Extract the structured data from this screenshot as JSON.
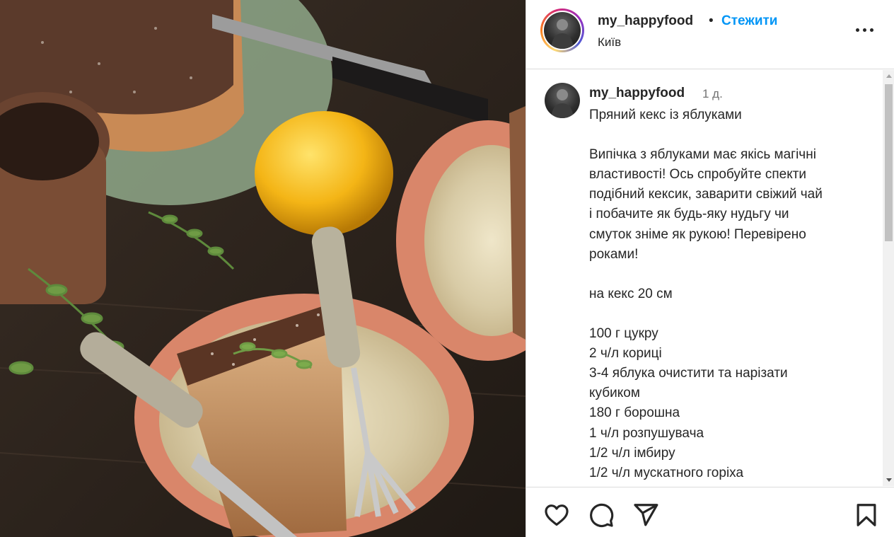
{
  "header": {
    "username": "my_happyfood",
    "dot": "•",
    "follow_label": "Стежити",
    "location": "Київ"
  },
  "caption": {
    "username": "my_happyfood",
    "time": "1 д.",
    "lines": [
      "Пряний кекс із яблуками",
      "",
      "Випічка з яблуками має якісь магічні",
      "властивості! Ось спробуйте спекти",
      "подібний кексик, заварити свіжий чай",
      "і побачите як будь-яку нудьгу чи",
      "смуток зніме як рукою! Перевірено",
      "роками!",
      "",
      "на кекс 20 см",
      "",
      "100 г цукру",
      "2 ч/л кориці",
      "3-4 яблука очистити та нарізати",
      "кубиком",
      "180 г борошна",
      "1 ч/л розпушувача",
      "1/2 ч/л імбиру",
      "1/2 ч/л мускатного горіха"
    ]
  },
  "actions": {
    "like_icon": "heart-icon",
    "comment_icon": "comment-icon",
    "share_icon": "send-icon",
    "save_icon": "bookmark-icon"
  },
  "colors": {
    "accent": "#0095f6",
    "text": "#262626",
    "muted": "#737373",
    "border": "#dbdbdb"
  }
}
